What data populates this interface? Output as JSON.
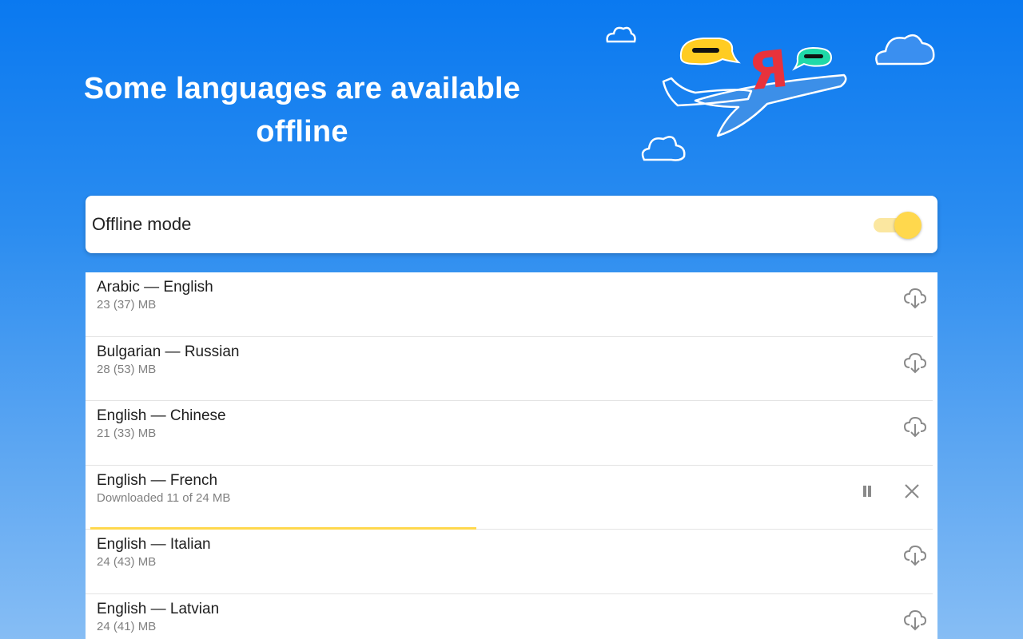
{
  "hero": {
    "title_line1": "Some languages are available",
    "title_line2": "offline",
    "illustration_letter": "Я"
  },
  "offline_mode": {
    "label": "Offline mode",
    "enabled": true
  },
  "languages": [
    {
      "name": "Arabic — English",
      "size": "23 (37) MB",
      "state": "available",
      "icon": "cloud-download-icon"
    },
    {
      "name": "Bulgarian — Russian",
      "size": "28 (53) MB",
      "state": "available",
      "icon": "cloud-download-icon"
    },
    {
      "name": "English — Chinese",
      "size": "21 (33) MB",
      "state": "available",
      "icon": "cloud-download-icon"
    },
    {
      "name": "English — French",
      "size": "Downloaded 11 of 24 MB",
      "state": "downloading",
      "progress": 0.4583,
      "icons": [
        "pause-icon",
        "close-icon"
      ]
    },
    {
      "name": "English — Italian",
      "size": "24 (43) MB",
      "state": "available",
      "icon": "cloud-download-icon"
    },
    {
      "name": "English — Latvian",
      "size": "24 (41) MB",
      "state": "available",
      "icon": "cloud-download-icon"
    }
  ],
  "colors": {
    "accent": "#ffd84d",
    "bubble_yellow": "#ffcc22",
    "bubble_green": "#1fd9a8",
    "letter_red": "#e8323c",
    "icon_gray": "#8a8a8a"
  }
}
